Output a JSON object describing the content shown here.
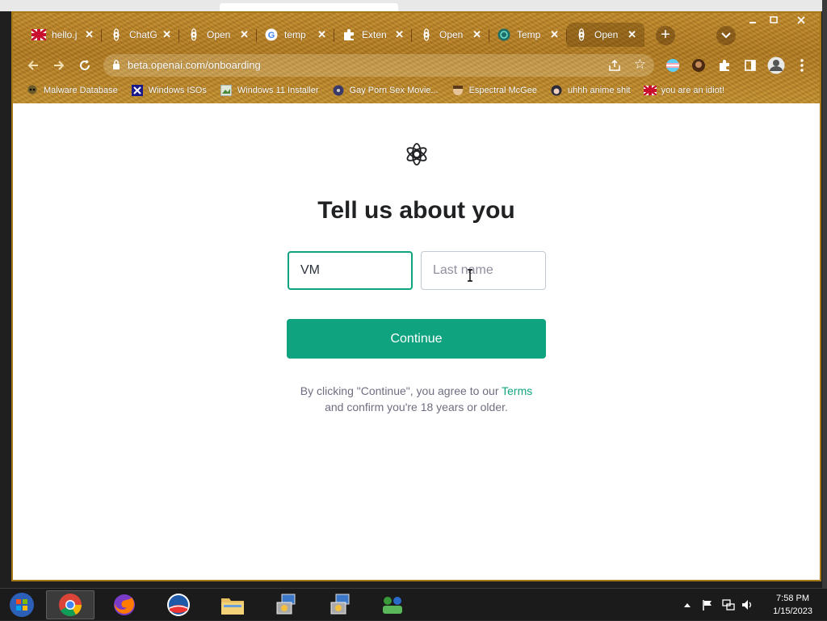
{
  "tabs": [
    {
      "title": "hello.j",
      "icon": "flag-icon"
    },
    {
      "title": "ChatG",
      "icon": "openai-icon"
    },
    {
      "title": "Open",
      "icon": "openai-icon"
    },
    {
      "title": "temp",
      "icon": "google-icon"
    },
    {
      "title": "Exten",
      "icon": "puzzle-icon"
    },
    {
      "title": "Open",
      "icon": "openai-icon"
    },
    {
      "title": "Temp",
      "icon": "temp-mail-icon"
    },
    {
      "title": "Open",
      "icon": "openai-icon"
    }
  ],
  "tab_close_glyph": "✕",
  "new_tab_glyph": "+",
  "url": "beta.openai.com/onboarding",
  "bookmarks": [
    {
      "label": "Malware Database",
      "icon": "skull-icon"
    },
    {
      "label": "Windows ISOs",
      "icon": "x-icon"
    },
    {
      "label": "Windows 11 Installer",
      "icon": "image-icon"
    },
    {
      "label": "Gay Porn Sex Movie...",
      "icon": "disc-icon"
    },
    {
      "label": "Espectral McGee",
      "icon": "face-icon"
    },
    {
      "label": "uhhh anime shit",
      "icon": "anime-icon"
    },
    {
      "label": "you are an idiot!",
      "icon": "flag-icon"
    }
  ],
  "page": {
    "heading": "Tell us about you",
    "first_name_value": "VM",
    "last_name_placeholder": "Last name",
    "continue_label": "Continue",
    "legal_line1_prefix": "By clicking \"Continue\", you agree to our ",
    "legal_terms": "Terms",
    "legal_line2": "and confirm you're 18 years or older."
  },
  "clock": {
    "time": "7:58 PM",
    "date": "1/15/2023"
  },
  "colors": {
    "accent": "#10a37f",
    "frame": "#b27a20"
  }
}
